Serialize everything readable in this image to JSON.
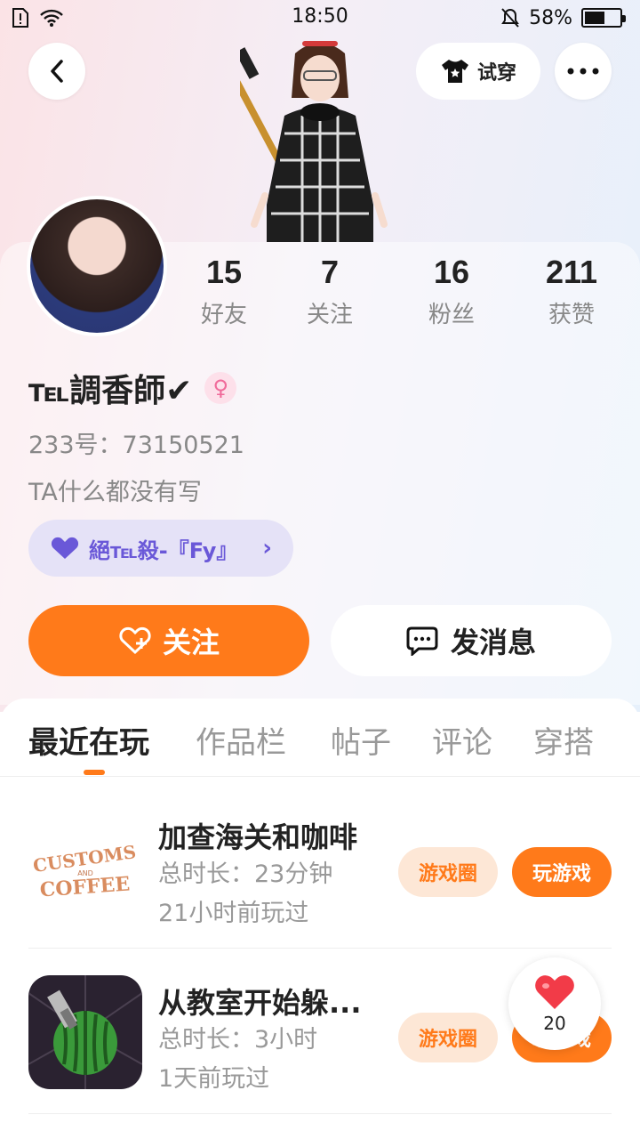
{
  "status_bar": {
    "time": "18:50",
    "battery_percent": "58%",
    "battery_level": 0.58
  },
  "top_bar": {
    "back_icon": "chevron-left-icon",
    "try_on_label": "试穿",
    "more_icon": "more-dots-icon"
  },
  "profile": {
    "stats": [
      {
        "value": "15",
        "label": "好友"
      },
      {
        "value": "7",
        "label": "关注"
      },
      {
        "value": "16",
        "label": "粉丝"
      },
      {
        "value": "211",
        "label": "获赞"
      }
    ],
    "username": "℡調香師✔",
    "gender_symbol": "♀",
    "user_id": "233号：73150521",
    "bio": "TA什么都没有写",
    "guild_name": "絕℡殺-『Fy』"
  },
  "actions": {
    "follow_label": "关注",
    "message_label": "发消息"
  },
  "tabs": [
    "最近在玩",
    "作品栏",
    "帖子",
    "评论",
    "穿搭"
  ],
  "games": [
    {
      "title": "加查海关和咖啡",
      "duration": "总时长：23分钟",
      "last_played": "21小时前玩过",
      "circle_label": "游戏圈",
      "play_label": "玩游戏"
    },
    {
      "title": "从教室开始躲...",
      "duration": "总时长：3小时",
      "last_played": "1天前玩过",
      "circle_label": "游戏圈",
      "play_label": "玩游戏"
    }
  ],
  "like_float": {
    "count": "20"
  },
  "colors": {
    "accent": "#ff7a1a",
    "guild_purple": "#6a58d8",
    "female_pink": "#f06a9a"
  }
}
